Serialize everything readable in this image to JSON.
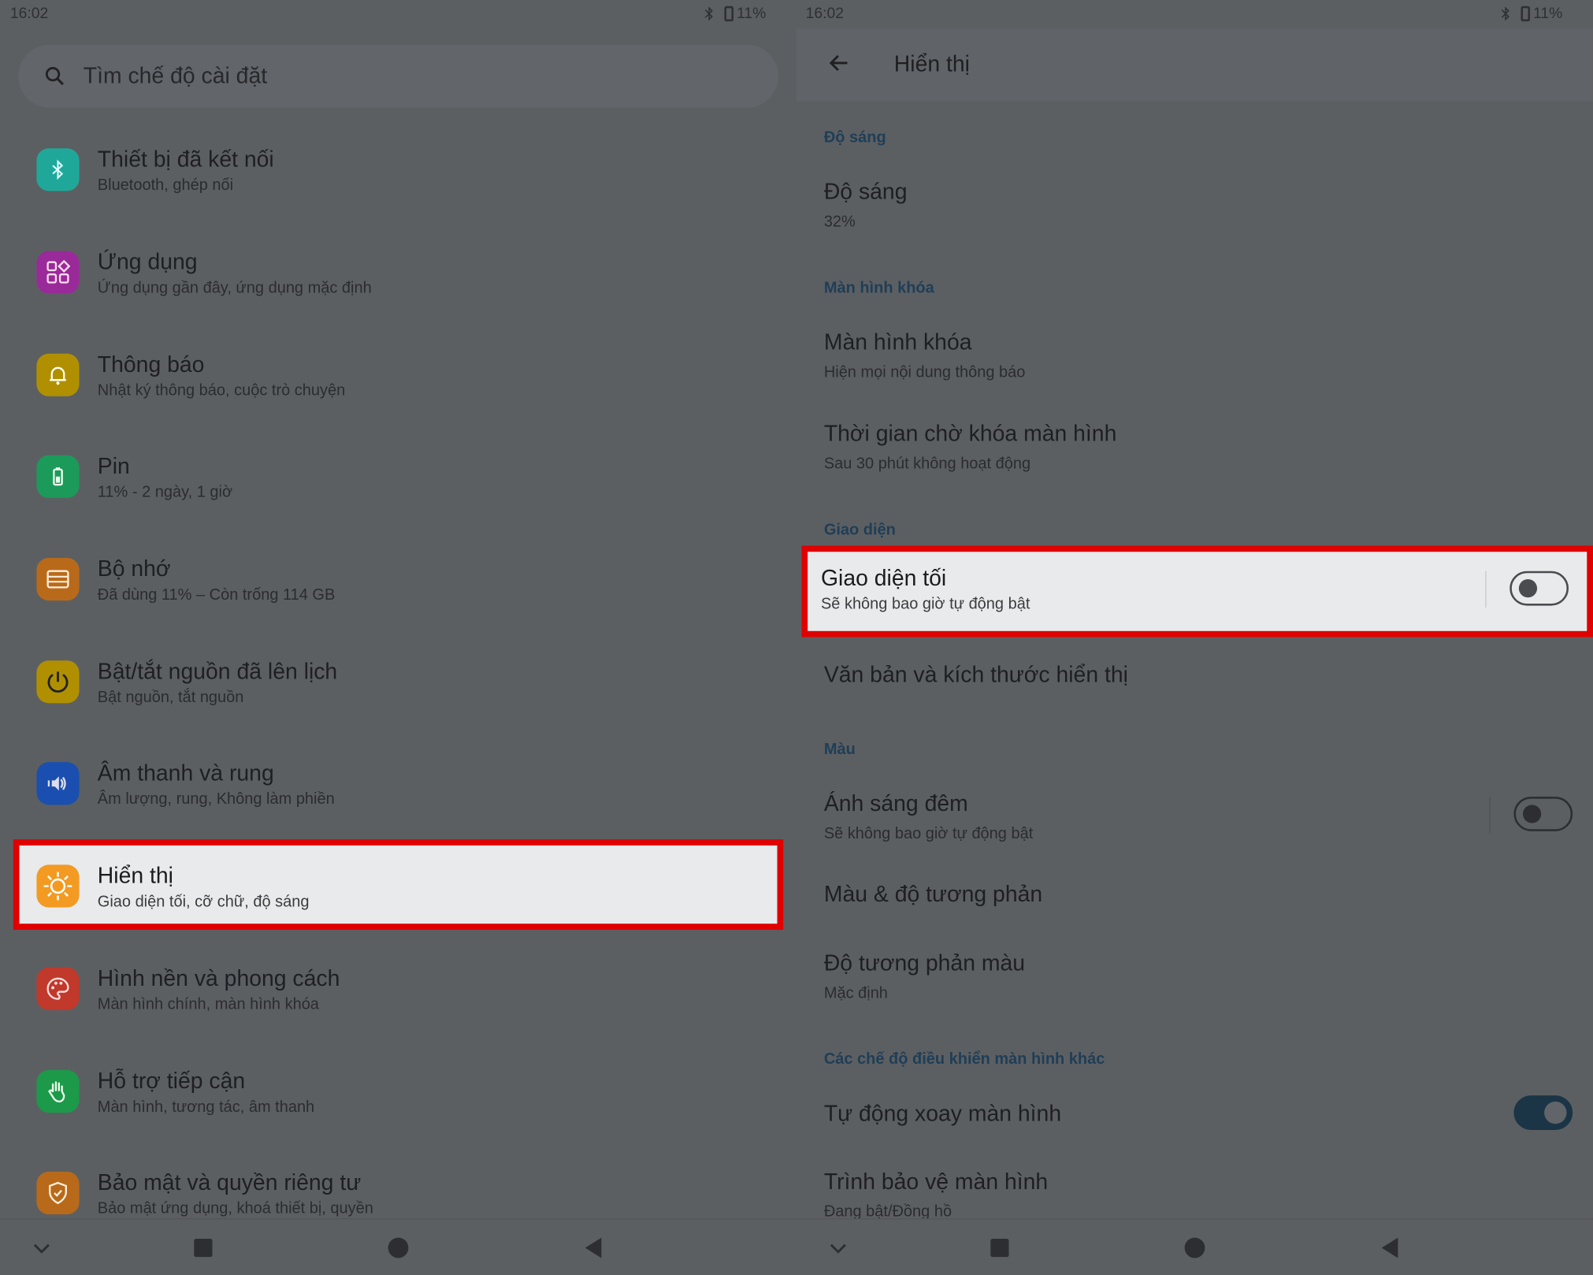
{
  "status": {
    "time": "16:02",
    "battery": "11%"
  },
  "left": {
    "search_placeholder": "Tìm chế độ cài đặt",
    "items": [
      {
        "title": "Thiết bị đã kết nối",
        "sub": "Bluetooth, ghép nối",
        "icon": "bluetooth-icon",
        "color": "#1fa89a"
      },
      {
        "title": "Ứng dụng",
        "sub": "Ứng dụng gần đây, ứng dụng mặc định",
        "icon": "apps-icon",
        "color": "#9a2a9a"
      },
      {
        "title": "Thông báo",
        "sub": "Nhật ký thông báo, cuộc trò chuyện",
        "icon": "bell-icon",
        "color": "#b09000"
      },
      {
        "title": "Pin",
        "sub": "11% - 2 ngày, 1 giờ",
        "icon": "battery-icon",
        "color": "#1c9a5a"
      },
      {
        "title": "Bộ nhớ",
        "sub": "Đã dùng 11% – Còn trống 114 GB",
        "icon": "storage-icon",
        "color": "#b86a1a"
      },
      {
        "title": "Bật/tắt nguồn đã lên lịch",
        "sub": "Bật nguồn, tắt nguồn",
        "icon": "power-icon",
        "color": "#b09000"
      },
      {
        "title": "Âm thanh và rung",
        "sub": "Âm lượng, rung, Không làm phiền",
        "icon": "speaker-icon",
        "color": "#1a4fb0"
      },
      {
        "title": "Hiển thị",
        "sub": "Giao diện tối, cỡ chữ, độ sáng",
        "icon": "brightness-icon",
        "color": "#f39a22"
      },
      {
        "title": "Hình nền và phong cách",
        "sub": "Màn hình chính, màn hình khóa",
        "icon": "palette-icon",
        "color": "#c0392b"
      },
      {
        "title": "Hỗ trợ tiếp cận",
        "sub": "Màn hình, tương tác, âm thanh",
        "icon": "hand-icon",
        "color": "#1c9a4a"
      },
      {
        "title": "Bảo mật và quyền riêng tư",
        "sub": "Bảo mật ứng dụng, khoá thiết bị, quyền",
        "icon": "shield-icon",
        "color": "#b86a1a"
      }
    ]
  },
  "right": {
    "title": "Hiển thị",
    "sec_brightness": "Độ sáng",
    "brightness_title": "Độ sáng",
    "brightness_value": "32%",
    "sec_lock": "Màn hình khóa",
    "lock_title": "Màn hình khóa",
    "lock_sub": "Hiện mọi nội dung thông báo",
    "timeout_title": "Thời gian chờ khóa màn hình",
    "timeout_sub": "Sau 30 phút không hoạt động",
    "sec_theme": "Giao diện",
    "dark_title": "Giao diện tối",
    "dark_sub": "Sẽ không bao giờ tự động bật",
    "text_size_title": "Văn bản và kích thước hiển thị",
    "sec_color": "Màu",
    "night_title": "Ánh sáng đêm",
    "night_sub": "Sẽ không bao giờ tự động bật",
    "contrast_title": "Màu & độ tương phản",
    "color_contrast_title": "Độ tương phản màu",
    "color_contrast_sub": "Mặc định",
    "sec_other": "Các chế độ điều khiển màn hình khác",
    "rotate_title": "Tự động xoay màn hình",
    "saver_title": "Trình bảo vệ màn hình",
    "saver_sub": "Đang bật/Đồng hồ"
  }
}
